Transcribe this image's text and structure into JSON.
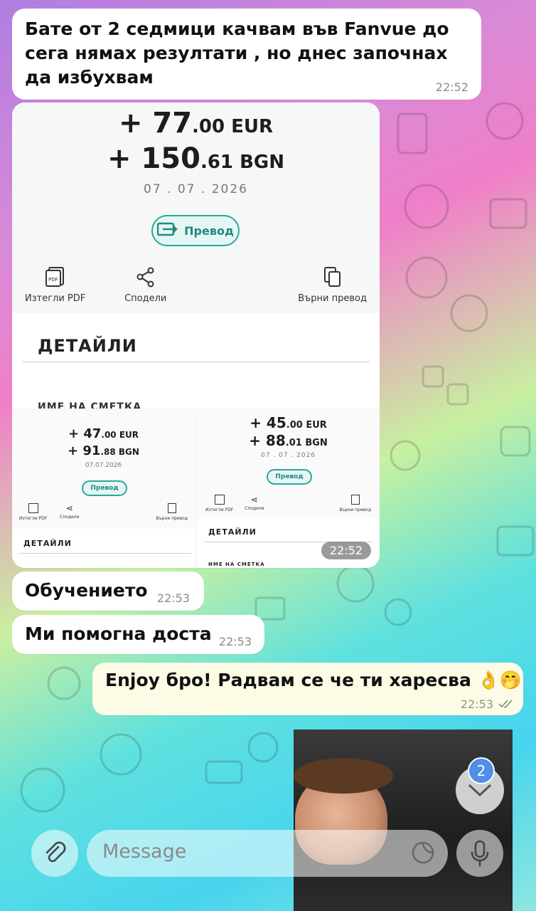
{
  "messages": {
    "m1": {
      "text": "Бате от 2 седмици качвам във Fanvue до сега нямах резултати , но днес започнах да избухвам",
      "time": "22:52"
    },
    "album": {
      "time": "22:52",
      "main": {
        "amount_eur_big": "+ 77",
        "amount_eur_small": ".00 EUR",
        "amount_bgn_big": "+ 150",
        "amount_bgn_small": ".61 BGN",
        "date": "07 . 07 . 2026",
        "transfer_label": "Превод",
        "download_pdf": "Изтегли PDF",
        "share": "Сподели",
        "return_transfer": "Върни превод",
        "details": "ДЕТАЙЛИ",
        "account_name": "ИМЕ НА СМЕТКА"
      },
      "left": {
        "amount_eur_big": "+ 47",
        "amount_eur_small": ".00 EUR",
        "amount_bgn_big": "+ 91",
        "amount_bgn_small": ".88 BGN",
        "date": "07.07.2026",
        "transfer_label": "Превод",
        "download_pdf": "Изтегли PDF",
        "share": "Сподели",
        "return_transfer": "Върни превод",
        "details": "ДЕТАЙЛИ"
      },
      "right": {
        "amount_eur_big": "+ 45",
        "amount_eur_small": ".00 EUR",
        "amount_bgn_big": "+ 88",
        "amount_bgn_small": ".01 BGN",
        "date": "07 . 07 . 2026",
        "transfer_label": "Превод",
        "download_pdf": "Изтегли PDF",
        "share": "Сподели",
        "return_transfer": "Върни превод",
        "details": "ДЕТАЙЛИ",
        "account_name": "ИМЕ НА СМЕТКА"
      }
    },
    "m2": {
      "text": "Обучението",
      "time": "22:53"
    },
    "m3": {
      "text": "Ми помогна доста",
      "time": "22:53"
    },
    "m4": {
      "text": "Enjoy бро! Радвам се че ти харесва 👌🤭",
      "time": "22:53"
    }
  },
  "scroll_badge": "2",
  "composer": {
    "placeholder": "Message"
  },
  "colors": {
    "accent": "#2aa89b",
    "incoming_bubble": "#ffffff",
    "outgoing_bubble": "#fbfbe6",
    "badge": "#4f8fe8"
  }
}
